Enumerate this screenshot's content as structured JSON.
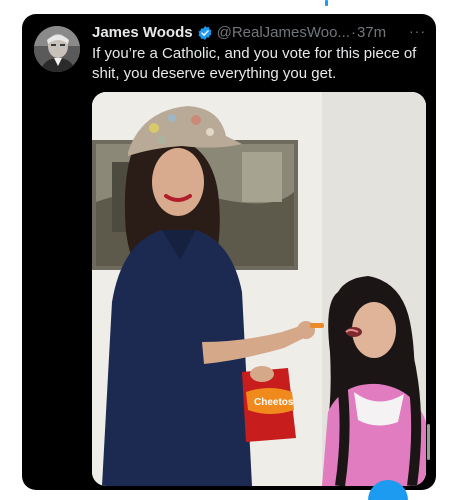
{
  "tweet": {
    "author_name": "James Woods",
    "handle": "@RealJamesWoo...",
    "separator": "·",
    "time": "37m",
    "more_label": "···",
    "text": "If you’re a Catholic, and you vote for this piece of shit, you deserve everything you get."
  },
  "media": {
    "bag_label": "Cheetos"
  },
  "colors": {
    "background": "#000000",
    "primary_text": "#e7e9ea",
    "secondary_text": "#71767b",
    "accent": "#1d9bf0"
  },
  "icons": {
    "verified": "verified-badge-icon",
    "more": "more-options-icon"
  }
}
